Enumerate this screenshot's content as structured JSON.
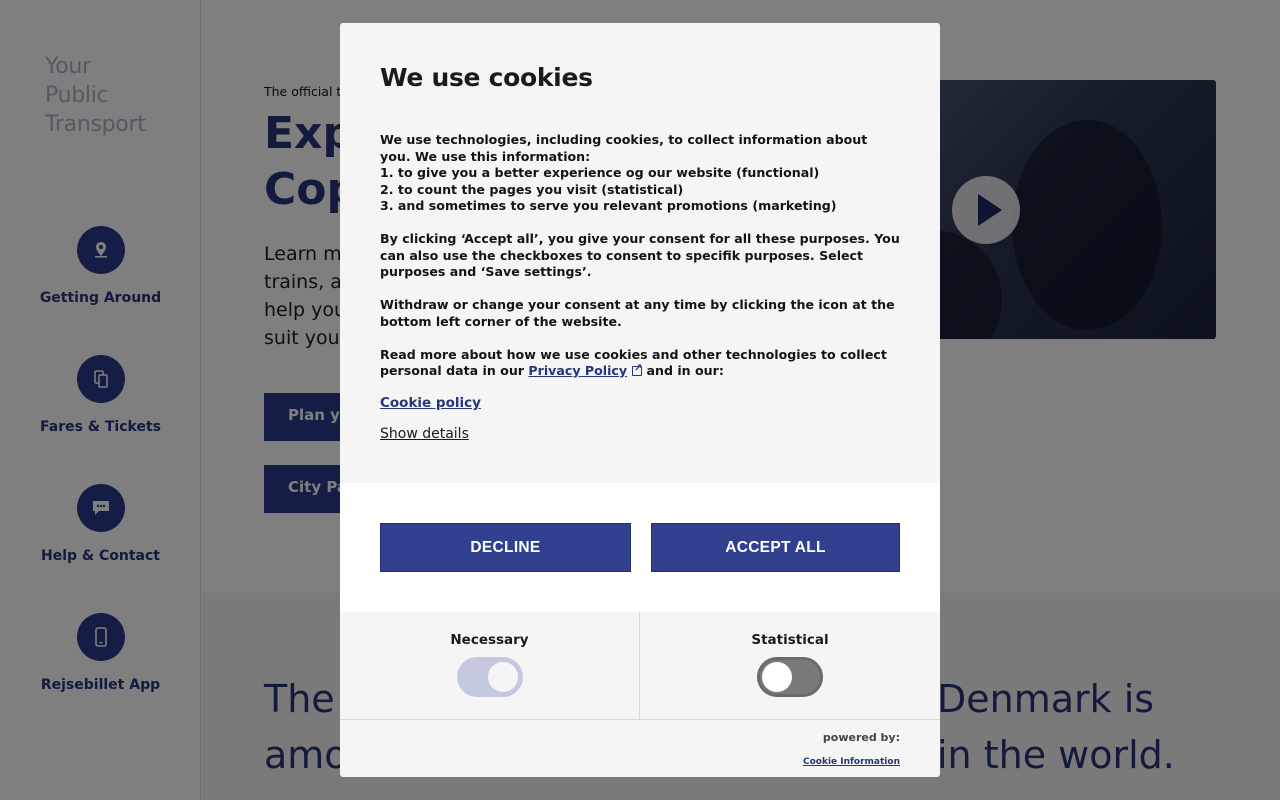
{
  "sidebar": {
    "logo_lines": [
      "Your",
      "Public",
      "Transport"
    ],
    "items": [
      {
        "label": "Getting Around",
        "icon": "location-pin-icon"
      },
      {
        "label": "Fares & Tickets",
        "icon": "tickets-icon"
      },
      {
        "label": "Help & Contact",
        "icon": "chat-icon"
      },
      {
        "label": "Rejsebillet App",
        "icon": "phone-icon"
      }
    ]
  },
  "hero": {
    "tagline": "The official t",
    "headline_line1": "Exp",
    "headline_line2": "Cop",
    "intro_lines": [
      "Learn mo",
      "trains, ar",
      "help you",
      "suit your"
    ],
    "cta_plan": "Plan yo",
    "cta_citypass": "City Pas"
  },
  "lower": {
    "line1_left": "The",
    "line1_right": "Denmark is",
    "line2_left": "amo",
    "line2_right": "in the world."
  },
  "cookie_dialog": {
    "title": "We use cookies",
    "intro": "We use technologies, including cookies, to collect information about you. We use this information:",
    "purposes": [
      "1. to give you a better experience og our website (functional)",
      "2. to count the pages you visit (statistical)",
      "3. and sometimes to serve you relevant promotions (marketing)"
    ],
    "consent_text": "By clicking ‘Accept all’, you give your consent for all these purposes. You can also use the checkboxes to consent to specifik purposes. Select purposes and ‘Save settings’.",
    "withdraw_text": "Withdraw or change your consent at any time by clicking the icon at the bottom left corner of the website.",
    "read_more_prefix": "Read more about how we use cookies and other technologies to collect personal data in our ",
    "privacy_policy_link": "Privacy Policy",
    "read_more_suffix": " and in our:",
    "cookie_policy_link": "Cookie policy",
    "show_details": "Show details",
    "decline_button": "DECLINE",
    "accept_all_button": "ACCEPT ALL",
    "categories": [
      {
        "label": "Necessary",
        "state": "on"
      },
      {
        "label": "Statistical",
        "state": "off"
      }
    ],
    "powered_by": "powered by:",
    "powered_by_link": "Cookie Information"
  },
  "colors": {
    "brand": "#2b3a8c",
    "button": "#30408f",
    "overlay": "rgba(0,0,0,0.5)"
  }
}
